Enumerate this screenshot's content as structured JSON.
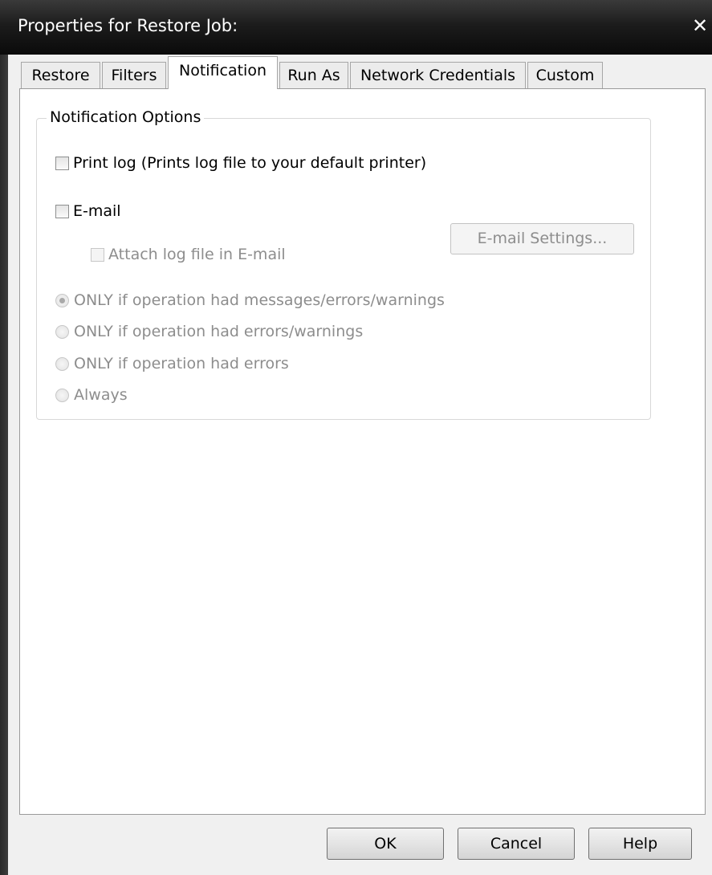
{
  "window": {
    "title": "Properties for Restore Job:",
    "close_glyph": "✕"
  },
  "tabs": [
    {
      "label": "Restore"
    },
    {
      "label": "Filters"
    },
    {
      "label": "Notification",
      "active": true
    },
    {
      "label": "Run As"
    },
    {
      "label": "Network Credentials"
    },
    {
      "label": "Custom"
    }
  ],
  "notification": {
    "group_label": "Notification Options",
    "print_log_label": "Print log (Prints log file to your default printer)",
    "print_log_checked": false,
    "email_label": "E-mail",
    "email_checked": false,
    "email_settings_label": "E-mail Settings...",
    "attach_log_label": "Attach log file in E-mail",
    "radios": [
      {
        "label": "ONLY if operation had messages/errors/warnings",
        "selected": true
      },
      {
        "label": "ONLY if operation had errors/warnings",
        "selected": false
      },
      {
        "label": "ONLY if operation had errors",
        "selected": false
      },
      {
        "label": "Always",
        "selected": false
      }
    ]
  },
  "buttons": {
    "ok": "OK",
    "cancel": "Cancel",
    "help": "Help"
  }
}
